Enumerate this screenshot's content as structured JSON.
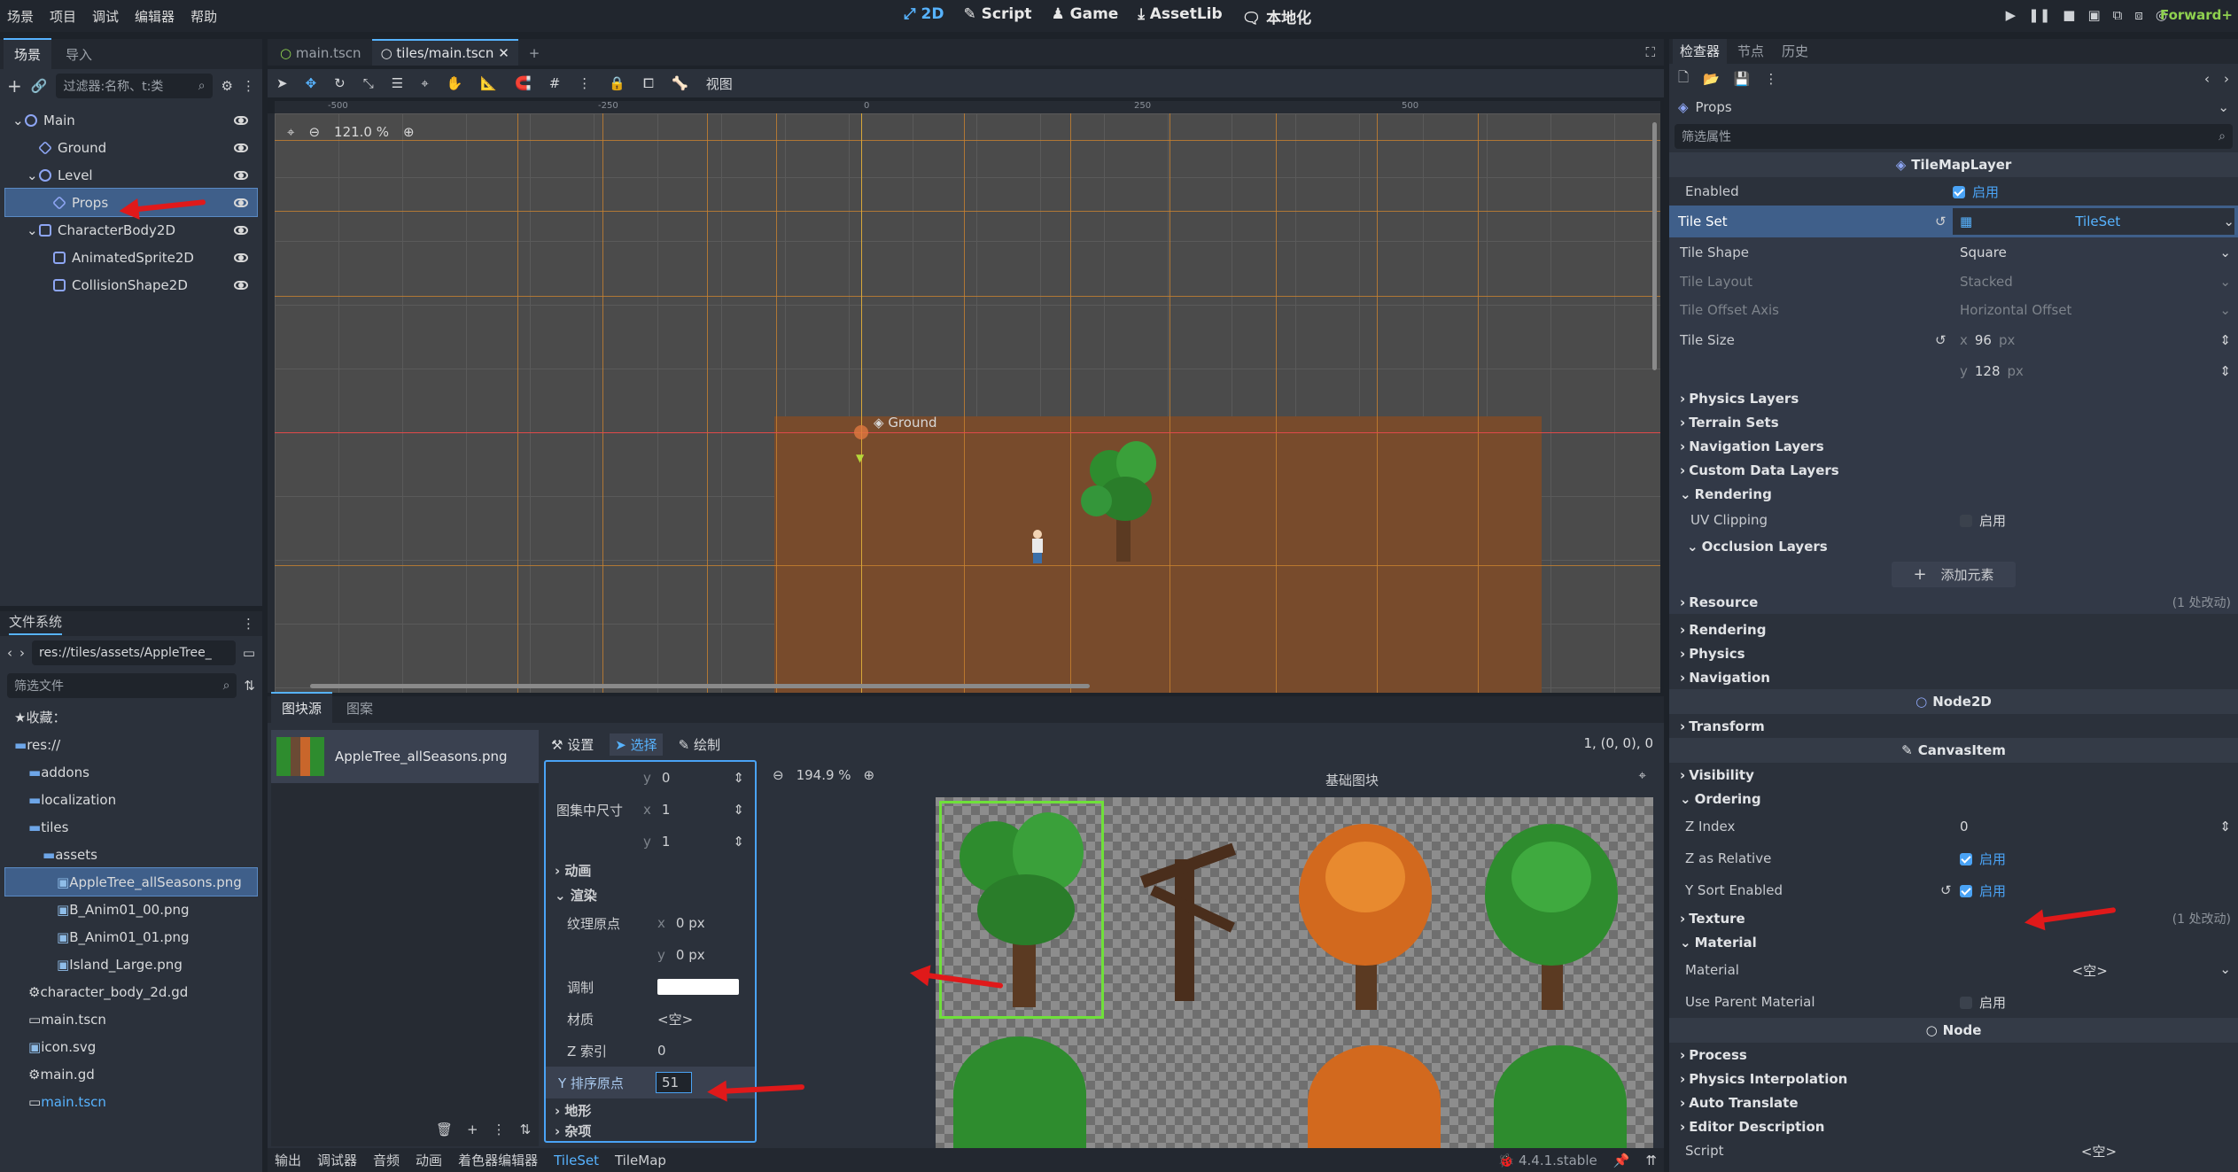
{
  "menubar": {
    "menus": [
      "场景",
      "项目",
      "调试",
      "编辑器",
      "帮助"
    ],
    "workspaces": [
      "2D",
      "Script",
      "Game",
      "AssetLib",
      "本地化"
    ],
    "active_workspace": "2D",
    "renderer": "Forward+"
  },
  "scene_dock": {
    "tabs": [
      "场景",
      "导入"
    ],
    "filter_placeholder": "过滤器:名称、t:类",
    "nodes": [
      {
        "label": "Main",
        "depth": 0,
        "icon": "node2d-icon",
        "color": "#8da5f3"
      },
      {
        "label": "Ground",
        "depth": 1,
        "icon": "tilemaplayer-icon",
        "color": "#8da5f3"
      },
      {
        "label": "Level",
        "depth": 1,
        "icon": "node2d-icon",
        "color": "#8da5f3"
      },
      {
        "label": "Props",
        "depth": 2,
        "icon": "tilemaplayer-icon",
        "color": "#8da5f3",
        "selected": true
      },
      {
        "label": "CharacterBody2D",
        "depth": 1,
        "icon": "characterbody2d-icon",
        "color": "#8da5f3"
      },
      {
        "label": "AnimatedSprite2D",
        "depth": 2,
        "icon": "animatedsprite-icon",
        "color": "#8da5f3"
      },
      {
        "label": "CollisionShape2D",
        "depth": 2,
        "icon": "collisionshape-icon",
        "color": "#8da5f3"
      }
    ]
  },
  "filesystem": {
    "title": "文件系统",
    "path": "res://tiles/assets/AppleTree_",
    "filter_placeholder": "筛选文件",
    "items": [
      {
        "label": "收藏：",
        "depth": 0
      },
      {
        "label": "res://",
        "depth": 0
      },
      {
        "label": "addons",
        "depth": 1
      },
      {
        "label": "localization",
        "depth": 1
      },
      {
        "label": "tiles",
        "depth": 1
      },
      {
        "label": "assets",
        "depth": 2
      },
      {
        "label": "AppleTree_allSeasons.png",
        "depth": 3,
        "selected": true
      },
      {
        "label": "B_Anim01_00.png",
        "depth": 3
      },
      {
        "label": "B_Anim01_01.png",
        "depth": 3
      },
      {
        "label": "Island_Large.png",
        "depth": 3
      },
      {
        "label": "character_body_2d.gd",
        "depth": 1
      },
      {
        "label": "main.tscn",
        "depth": 1
      },
      {
        "label": "icon.svg",
        "depth": 1
      },
      {
        "label": "main.gd",
        "depth": 1
      },
      {
        "label": "main.tscn",
        "depth": 1,
        "highlight": true
      }
    ]
  },
  "editor_tabs": [
    "main.tscn",
    "tiles/main.tscn"
  ],
  "active_editor_tab": "tiles/main.tscn",
  "toolbar": {
    "view_label": "视图"
  },
  "viewport": {
    "zoom": "121.0 %",
    "ruler_labels": [
      "-500",
      "-250",
      "0",
      "250",
      "500"
    ],
    "ground_label": "Ground"
  },
  "tileset_panel": {
    "tabs": [
      "图块源",
      "图案"
    ],
    "source_name": "AppleTree_allSeasons.png",
    "mode_tabs": [
      "设置",
      "选择",
      "绘制"
    ],
    "coords": "1, (0, 0), 0",
    "zoom": "194.9 %",
    "atlas_title": "基础图块",
    "props": [
      {
        "label": "",
        "axis": "y",
        "value": "0"
      },
      {
        "label": "图集中尺寸",
        "axis": "x",
        "value": "1"
      },
      {
        "label": "",
        "axis": "y",
        "value": "1"
      }
    ],
    "sections": [
      "动画",
      "渲染"
    ],
    "render_props": {
      "texture_origin_label": "纹理原点",
      "texture_origin_x": "0 px",
      "texture_origin_y": "0 px",
      "modulate_label": "调制",
      "material_label": "材质",
      "material_value": "<空>",
      "z_index_label": "Z 索引",
      "z_index_value": "0",
      "y_sort_label": "Y 排序原点",
      "y_sort_value": "51"
    },
    "bottom_sections": [
      "地形",
      "杂项"
    ]
  },
  "bottom_bar": {
    "tabs": [
      "输出",
      "调试器",
      "音频",
      "动画",
      "着色器编辑器",
      "TileSet",
      "TileMap"
    ],
    "active": "TileSet",
    "version": "4.4.1.stable"
  },
  "inspector": {
    "tabs": [
      "检查器",
      "节点",
      "历史"
    ],
    "resource": "Props",
    "filter_placeholder": "筛选属性",
    "class_header": "TileMapLayer",
    "enabled": {
      "label": "Enabled",
      "value": "启用"
    },
    "tile_set": {
      "label": "Tile Set",
      "value": "TileSet"
    },
    "tile_shape": {
      "label": "Tile Shape",
      "value": "Square"
    },
    "tile_layout": {
      "label": "Tile Layout",
      "value": "Stacked"
    },
    "tile_offset_axis": {
      "label": "Tile Offset Axis",
      "value": "Horizontal Offset"
    },
    "tile_size": {
      "label": "Tile Size",
      "x": "96",
      "y": "128",
      "unit": "px"
    },
    "tileset_sections": [
      "Physics Layers",
      "Terrain Sets",
      "Navigation Layers",
      "Custom Data Layers",
      "Rendering"
    ],
    "uv_clipping": {
      "label": "UV Clipping",
      "value": "启用"
    },
    "occlusion": "Occlusion Layers",
    "add_element": "添加元素",
    "resource_section": "Resource",
    "resource_changes": "(1 处改动)",
    "layer_sections": [
      "Rendering",
      "Physics",
      "Navigation"
    ],
    "node2d": "Node2D",
    "transform": "Transform",
    "canvasitem": "CanvasItem",
    "visibility": "Visibility",
    "ordering": "Ordering",
    "z_index": {
      "label": "Z Index",
      "value": "0"
    },
    "z_as_relative": {
      "label": "Z as Relative",
      "value": "启用"
    },
    "y_sort": {
      "label": "Y Sort Enabled",
      "value": "启用"
    },
    "texture": "Texture",
    "texture_changes": "(1 处改动)",
    "material_section": "Material",
    "material": {
      "label": "Material",
      "value": "<空>"
    },
    "use_parent_material": {
      "label": "Use Parent Material",
      "value": "启用"
    },
    "node": "Node",
    "node_sections": [
      "Process",
      "Physics Interpolation",
      "Auto Translate",
      "Editor Description"
    ],
    "script": {
      "label": "Script",
      "value": "<空>"
    }
  },
  "colors": {
    "accent": "#57b3ff",
    "annotation_arrow": "#e0191a",
    "selection": "#4aa3f5",
    "ground_fill": "#7a4b2a"
  }
}
